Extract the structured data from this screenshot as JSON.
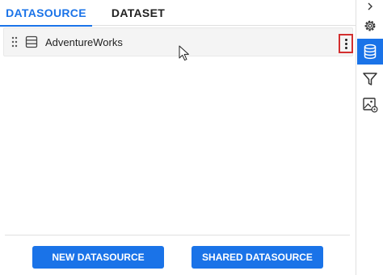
{
  "tabs": [
    {
      "label": "DATASOURCE",
      "active": true
    },
    {
      "label": "DATASET",
      "active": false
    }
  ],
  "datasource_row": {
    "label": "AdventureWorks",
    "icon": "database-icon",
    "handle_icon": "drag-handle-icon",
    "menu_icon": "kebab-menu-icon"
  },
  "buttons": {
    "new_label": "NEW DATASOURCE",
    "shared_label": "SHARED DATASOURCE"
  },
  "side_panel": {
    "items": [
      "chevron-right-icon",
      "gear-icon",
      "database-icon",
      "filter-icon",
      "image-settings-icon"
    ],
    "active": "database-icon"
  },
  "colors": {
    "accent": "#1a73e8",
    "highlight_border": "#d32f2f",
    "row_background": "#f4f4f4"
  }
}
